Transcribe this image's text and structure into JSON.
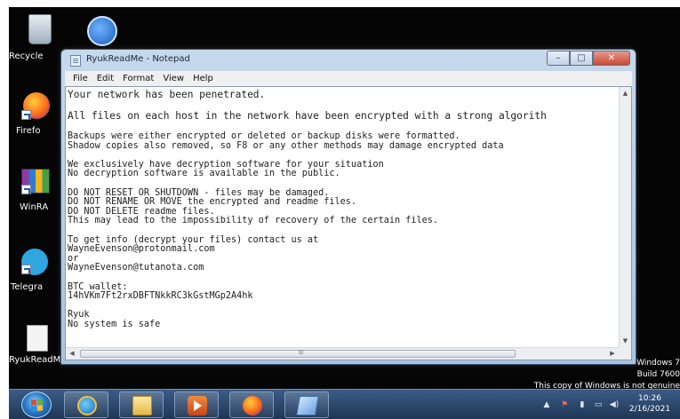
{
  "desktop": {
    "icons": [
      {
        "label": "Recycle"
      },
      {
        "label": ""
      },
      {
        "label": "Firefo"
      },
      {
        "label": "WinRA"
      },
      {
        "label": "Telegra"
      },
      {
        "label": "RyukReadMe"
      }
    ]
  },
  "window": {
    "title": "RyukReadMe - Notepad",
    "buttons": {
      "minimize": "–",
      "maximize": "□",
      "close": "✕"
    },
    "menu": [
      "File",
      "Edit",
      "Format",
      "View",
      "Help"
    ]
  },
  "note": {
    "lines": [
      "Your network has been penetrated.",
      "",
      "All files on each host in the network have been encrypted with a strong algorith",
      "",
      "Backups were either encrypted or deleted or backup disks were formatted.",
      "Shadow copies also removed, so F8 or any other methods may damage encrypted data",
      "",
      "We exclusively have decryption software for your situation",
      "No decryption software is available in the public.",
      "",
      "DO NOT RESET OR SHUTDOWN - files may be damaged.",
      "DO NOT RENAME OR MOVE the encrypted and readme files.",
      "DO NOT DELETE readme files.",
      "This may lead to the impossibility of recovery of the certain files.",
      "",
      "To get info (decrypt your files) contact us at",
      "WayneEvenson@protonmail.com",
      "or",
      "WayneEvenson@tutanota.com",
      "",
      "BTC wallet:",
      "14hVKm7Ft2rxDBFTNkkRC3kGstMGp2A4hk",
      "",
      "Ryuk",
      "No system is safe"
    ]
  },
  "watermark": {
    "line1": "Windows 7",
    "line2": "Build 7600",
    "line3": "This copy of Windows is not genuine"
  },
  "taskbar": {
    "clock_time": "10:26",
    "clock_date": "2/16/2021",
    "tray": {
      "arrow": "▲",
      "flag": "⚑",
      "power": "▮",
      "network": "▭",
      "volume": "◀)"
    }
  },
  "scroll": {
    "up": "▲",
    "down": "▼",
    "left": "◀",
    "right": "▶",
    "grip": "III"
  }
}
